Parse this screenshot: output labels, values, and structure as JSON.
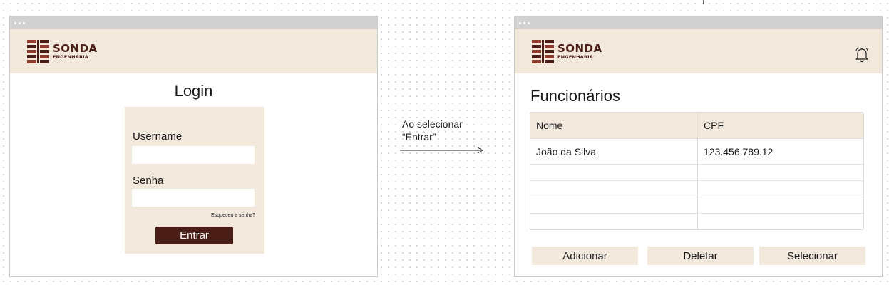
{
  "login_screen": {
    "brand": {
      "name": "SONDA",
      "subtitle": "ENGENHARIA"
    },
    "title": "Login",
    "username": {
      "label": "Username",
      "value": "",
      "placeholder": ""
    },
    "password": {
      "label": "Senha",
      "value": "",
      "placeholder": ""
    },
    "forgot_link": "Esqueceu a senha?",
    "submit_label": "Entrar"
  },
  "transition": {
    "line1": "Ao selecionar",
    "line2": "“Entrar”"
  },
  "employees_screen": {
    "brand": {
      "name": "SONDA",
      "subtitle": "ENGENHARIA"
    },
    "notification_icon": "bell-icon",
    "title": "Funcionários",
    "table": {
      "columns": [
        "Nome",
        "CPF"
      ],
      "rows": [
        [
          "João da Silva",
          "123.456.789.12"
        ],
        [
          "",
          ""
        ],
        [
          "",
          ""
        ],
        [
          "",
          ""
        ],
        [
          "",
          ""
        ]
      ]
    },
    "actions": {
      "add_label": "Adicionar",
      "delete_label": "Deletar",
      "select_label": "Selecionar"
    }
  },
  "colors": {
    "brand_dark": "#4a1e16",
    "header_bg": "#f2e8dc",
    "titlebar_bg": "#d1d1d1"
  }
}
